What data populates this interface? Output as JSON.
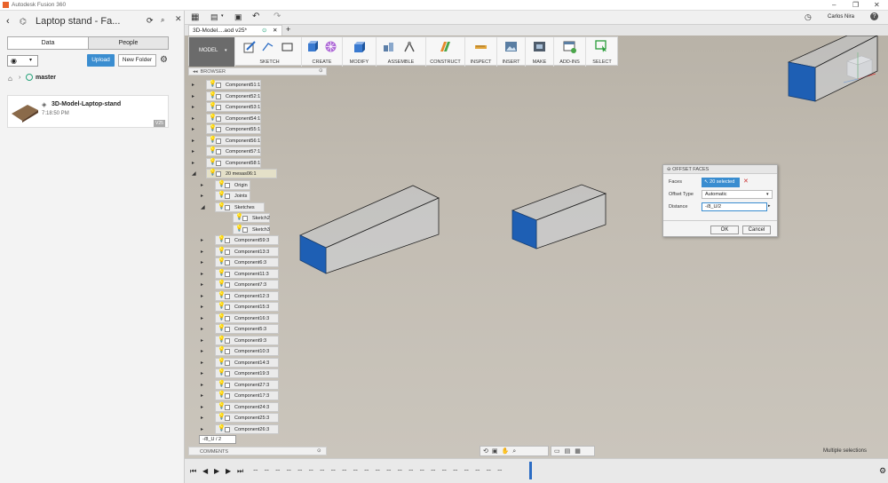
{
  "app": {
    "title": "Autodesk Fusion 360"
  },
  "window_controls": [
    "–",
    "❐",
    "✕"
  ],
  "user": {
    "name": "Carlos Nira",
    "help": "?"
  },
  "data_panel": {
    "project_title": "Laptop stand - Fa...",
    "tabs": [
      "Data",
      "People"
    ],
    "upload_label": "Upload",
    "new_folder_label": "New Folder",
    "branch": "master",
    "file": {
      "name": "3D-Model-Laptop-stand",
      "time": "7:18:50 PM",
      "version": "V25"
    }
  },
  "document_tab": {
    "label": "3D-Model....aod v25*"
  },
  "toolbar": {
    "workspace": "MODEL",
    "groups": [
      "SKETCH",
      "CREATE",
      "MODIFY",
      "ASSEMBLE",
      "CONSTRUCT",
      "INSPECT",
      "INSERT",
      "MAKE",
      "ADD-INS",
      "SELECT"
    ]
  },
  "browser": {
    "title": "BROWSER",
    "rows_a": [
      "Component51:1",
      "Component52:1",
      "Component53:1",
      "Component54:1",
      "Component55:1",
      "Component56:1",
      "Component57:1",
      "Component58:1"
    ],
    "selected_root": "20 mesas06:1",
    "folders": [
      "Origin",
      "Joints",
      "Sketches"
    ],
    "sketches": [
      "Sketch2",
      "Sketch3"
    ],
    "rows_b": [
      "Component59:3",
      "Component13:3",
      "Component6:3",
      "Component11:3",
      "Component7:3",
      "Component12:3",
      "Component15:3",
      "Component16:3",
      "Component5:3",
      "Component9:3",
      "Component10:3",
      "Component14:3",
      "Component19:3",
      "Component27:3",
      "Component17:3",
      "Component24:3",
      "Component25:3",
      "Component26:3"
    ]
  },
  "dialog": {
    "title": "OFFSET FACES",
    "faces_label": "Faces",
    "faces_value": "20 selected",
    "offset_type_label": "Offset Type",
    "offset_type_value": "Automatic",
    "distance_label": "Distance",
    "distance_value": "-/8_U/2",
    "ok": "OK",
    "cancel": "Cancel"
  },
  "comments": {
    "title": "COMMENTS"
  },
  "status": {
    "text": "Multiple selections",
    "param_field": "-/8_U / 2"
  },
  "colors": {
    "face_blue": "#1e5fb4",
    "toolbar_bg": "#f7f7f7"
  }
}
